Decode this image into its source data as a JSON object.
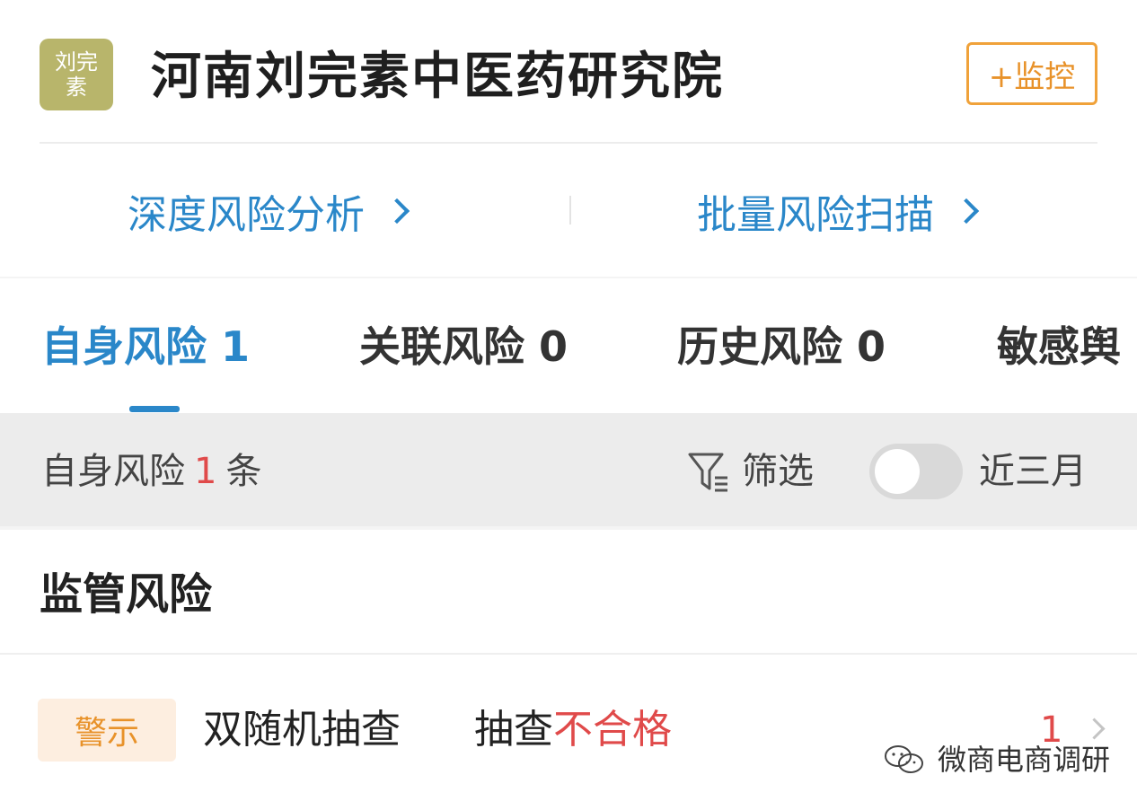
{
  "header": {
    "logo_text": "刘完素",
    "company_name": "河南刘完素中医药研究院",
    "monitor_button": "+监控",
    "deep_risk_link": "深度风险分析",
    "batch_scan_link": "批量风险扫描"
  },
  "tabs": [
    {
      "label": "自身风险 1"
    },
    {
      "label": "关联风险 0"
    },
    {
      "label": "历史风险 0"
    },
    {
      "label": "敏感舆"
    }
  ],
  "filter_bar": {
    "count_prefix": "自身风险",
    "count": "1",
    "count_suffix": "条",
    "filter_label": "筛选",
    "recent_label": "近三月",
    "recent_toggle_on": false
  },
  "section": {
    "title": "监管风险",
    "rows": [
      {
        "badge": "警示",
        "type": "双随机抽查",
        "desc_prefix": "抽查",
        "desc_highlight": "不合格",
        "count": "1"
      }
    ]
  },
  "watermark": {
    "text": "微商电商调研"
  },
  "colors": {
    "accent": "#2a87c9",
    "warning": "#e8922a",
    "danger": "#e04a4a",
    "logo_bg": "#b8b56b"
  }
}
